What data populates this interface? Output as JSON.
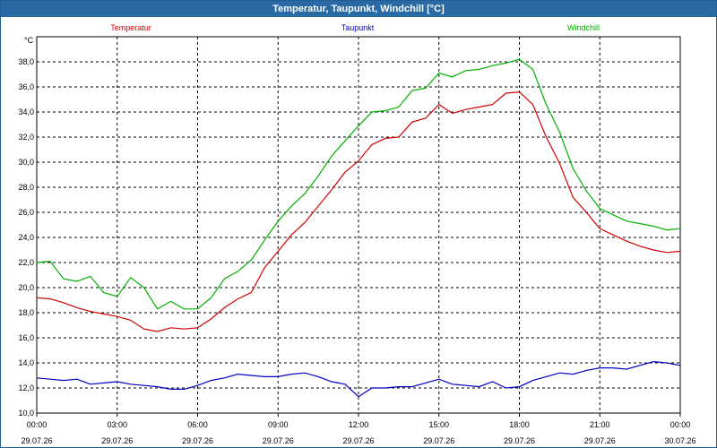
{
  "window": {
    "title": "Temperatur, Taupunkt, Windchill [°C]"
  },
  "colors": {
    "title_bg": "#2a6aa4",
    "temperatur": "#d00000",
    "taupunkt": "#0000c0",
    "windchill": "#00b000"
  },
  "chart_data": {
    "type": "line",
    "title": "Temperatur, Taupunkt, Windchill [°C]",
    "ylabel": "°C",
    "ylim": [
      10.0,
      40.0
    ],
    "yticks": [
      10,
      12,
      14,
      16,
      18,
      20,
      22,
      24,
      26,
      28,
      30,
      32,
      34,
      36,
      38
    ],
    "ytick_labels": [
      "10,0",
      "12,0",
      "14,0",
      "16,0",
      "18,0",
      "20,0",
      "22,0",
      "24,0",
      "26,0",
      "28,0",
      "30,0",
      "32,0",
      "34,0",
      "36,0",
      "38,0"
    ],
    "xlim": [
      "29.07.26 00:00",
      "30.07.26 00:00"
    ],
    "xticks": [
      {
        "time": "00:00",
        "date": "29.07.26"
      },
      {
        "time": "03:00",
        "date": "29.07.26"
      },
      {
        "time": "06:00",
        "date": "29.07.26"
      },
      {
        "time": "09:00",
        "date": "29.07.26"
      },
      {
        "time": "12:00",
        "date": "29.07.26"
      },
      {
        "time": "15:00",
        "date": "29.07.26"
      },
      {
        "time": "18:00",
        "date": "29.07.26"
      },
      {
        "time": "21:00",
        "date": "29.07.26"
      },
      {
        "time": "00:00",
        "date": "30.07.26"
      }
    ],
    "grid": true,
    "legend_position": "top",
    "x_hours": [
      0,
      0.5,
      1,
      1.5,
      2,
      2.5,
      3,
      3.5,
      4,
      4.5,
      5,
      5.5,
      6,
      6.5,
      7,
      7.5,
      8,
      8.5,
      9,
      9.5,
      10,
      10.5,
      11,
      11.5,
      12,
      12.5,
      13,
      13.5,
      14,
      14.5,
      15,
      15.5,
      16,
      16.5,
      17,
      17.5,
      18,
      18.5,
      19,
      19.5,
      20,
      20.5,
      21,
      21.5,
      22,
      22.5,
      23,
      23.5,
      24
    ],
    "series": [
      {
        "name": "Temperatur",
        "color": "#d00000",
        "values": [
          19.2,
          19.1,
          18.8,
          18.4,
          18.1,
          17.9,
          17.7,
          17.4,
          16.7,
          16.5,
          16.8,
          16.7,
          16.8,
          17.5,
          18.4,
          19.1,
          19.6,
          21.6,
          22.9,
          24.2,
          25.2,
          26.5,
          27.8,
          29.2,
          30.1,
          31.4,
          31.9,
          32.0,
          33.2,
          33.5,
          34.6,
          33.9,
          34.2,
          34.4,
          34.6,
          35.5,
          35.6,
          34.6,
          32.0,
          29.9,
          27.2,
          26.0,
          24.7,
          24.2,
          23.7,
          23.3,
          23.0,
          22.8,
          22.9
        ]
      },
      {
        "name": "Taupunkt",
        "color": "#0000c0",
        "values": [
          12.8,
          12.7,
          12.6,
          12.7,
          12.3,
          12.4,
          12.5,
          12.3,
          12.2,
          12.1,
          11.9,
          11.9,
          12.2,
          12.6,
          12.8,
          13.1,
          13.0,
          12.9,
          12.9,
          13.1,
          13.2,
          12.9,
          12.5,
          12.3,
          11.3,
          12.0,
          12.0,
          12.1,
          12.1,
          12.4,
          12.7,
          12.3,
          12.2,
          12.1,
          12.5,
          12.0,
          12.1,
          12.6,
          12.9,
          13.2,
          13.1,
          13.4,
          13.6,
          13.6,
          13.5,
          13.8,
          14.1,
          14.0,
          13.8
        ]
      },
      {
        "name": "Windchill",
        "color": "#00b000",
        "values": [
          22.0,
          22.1,
          20.7,
          20.5,
          20.9,
          19.6,
          19.3,
          20.8,
          20.0,
          18.3,
          18.9,
          18.3,
          18.3,
          19.2,
          20.7,
          21.3,
          22.2,
          23.8,
          25.3,
          26.5,
          27.5,
          28.9,
          30.5,
          31.7,
          32.9,
          34.0,
          34.1,
          34.4,
          35.7,
          35.9,
          37.1,
          36.8,
          37.3,
          37.4,
          37.7,
          37.9,
          38.2,
          37.4,
          34.6,
          32.4,
          29.5,
          27.7,
          26.3,
          25.8,
          25.3,
          25.1,
          24.9,
          24.6,
          24.7
        ]
      }
    ]
  }
}
